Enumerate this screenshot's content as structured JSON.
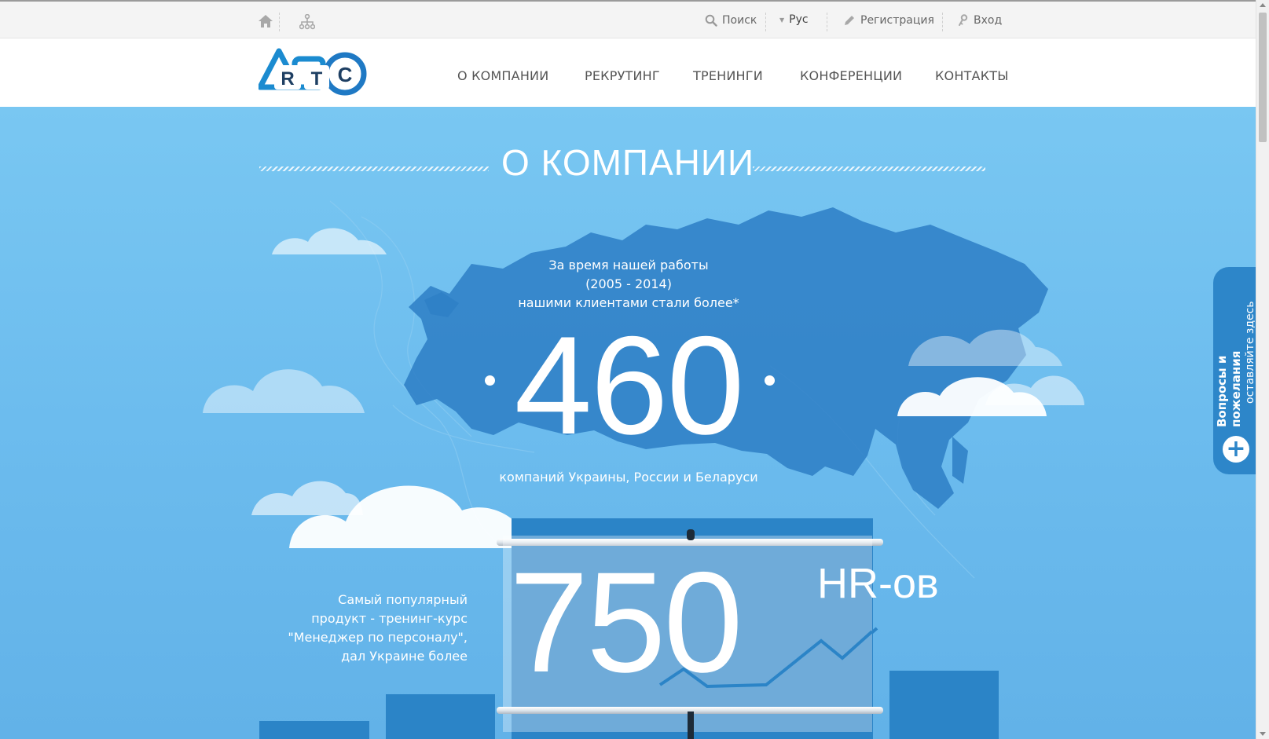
{
  "topbar": {
    "search_label": "Поиск",
    "language_label": "Рус",
    "register_label": "Регистрация",
    "login_label": "Вход"
  },
  "header": {
    "logo_letters": [
      "R",
      "T",
      "C"
    ],
    "nav": [
      "О КОМПАНИИ",
      "РЕКРУТИНГ",
      "ТРЕНИНГИ",
      "КОНФЕРЕНЦИИ",
      "КОНТАКТЫ"
    ]
  },
  "hero": {
    "title": "О КОМПАНИИ",
    "intro_lines": [
      "За время нашей работы",
      "(2005 - 2014)",
      "нашими клиентами стали более*"
    ],
    "clients_count": "460",
    "clients_caption": "компаний Украины, России и Беларуси",
    "product_lines": [
      "Самый популярный",
      "продукт - тренинг-курс",
      "\"Менеджер по персоналу\",",
      "дал Украине более"
    ],
    "hr_count": "750",
    "hr_suffix": "HR-ов"
  },
  "feedback": {
    "title": "Вопросы и пожелания",
    "subtitle": "оставляйте здесь",
    "plus": "+"
  },
  "colors": {
    "sky": "#6cbcee",
    "map": "#2f7fc6",
    "bar": "#2b84c7",
    "logo_blue": "#1b8bd0"
  }
}
